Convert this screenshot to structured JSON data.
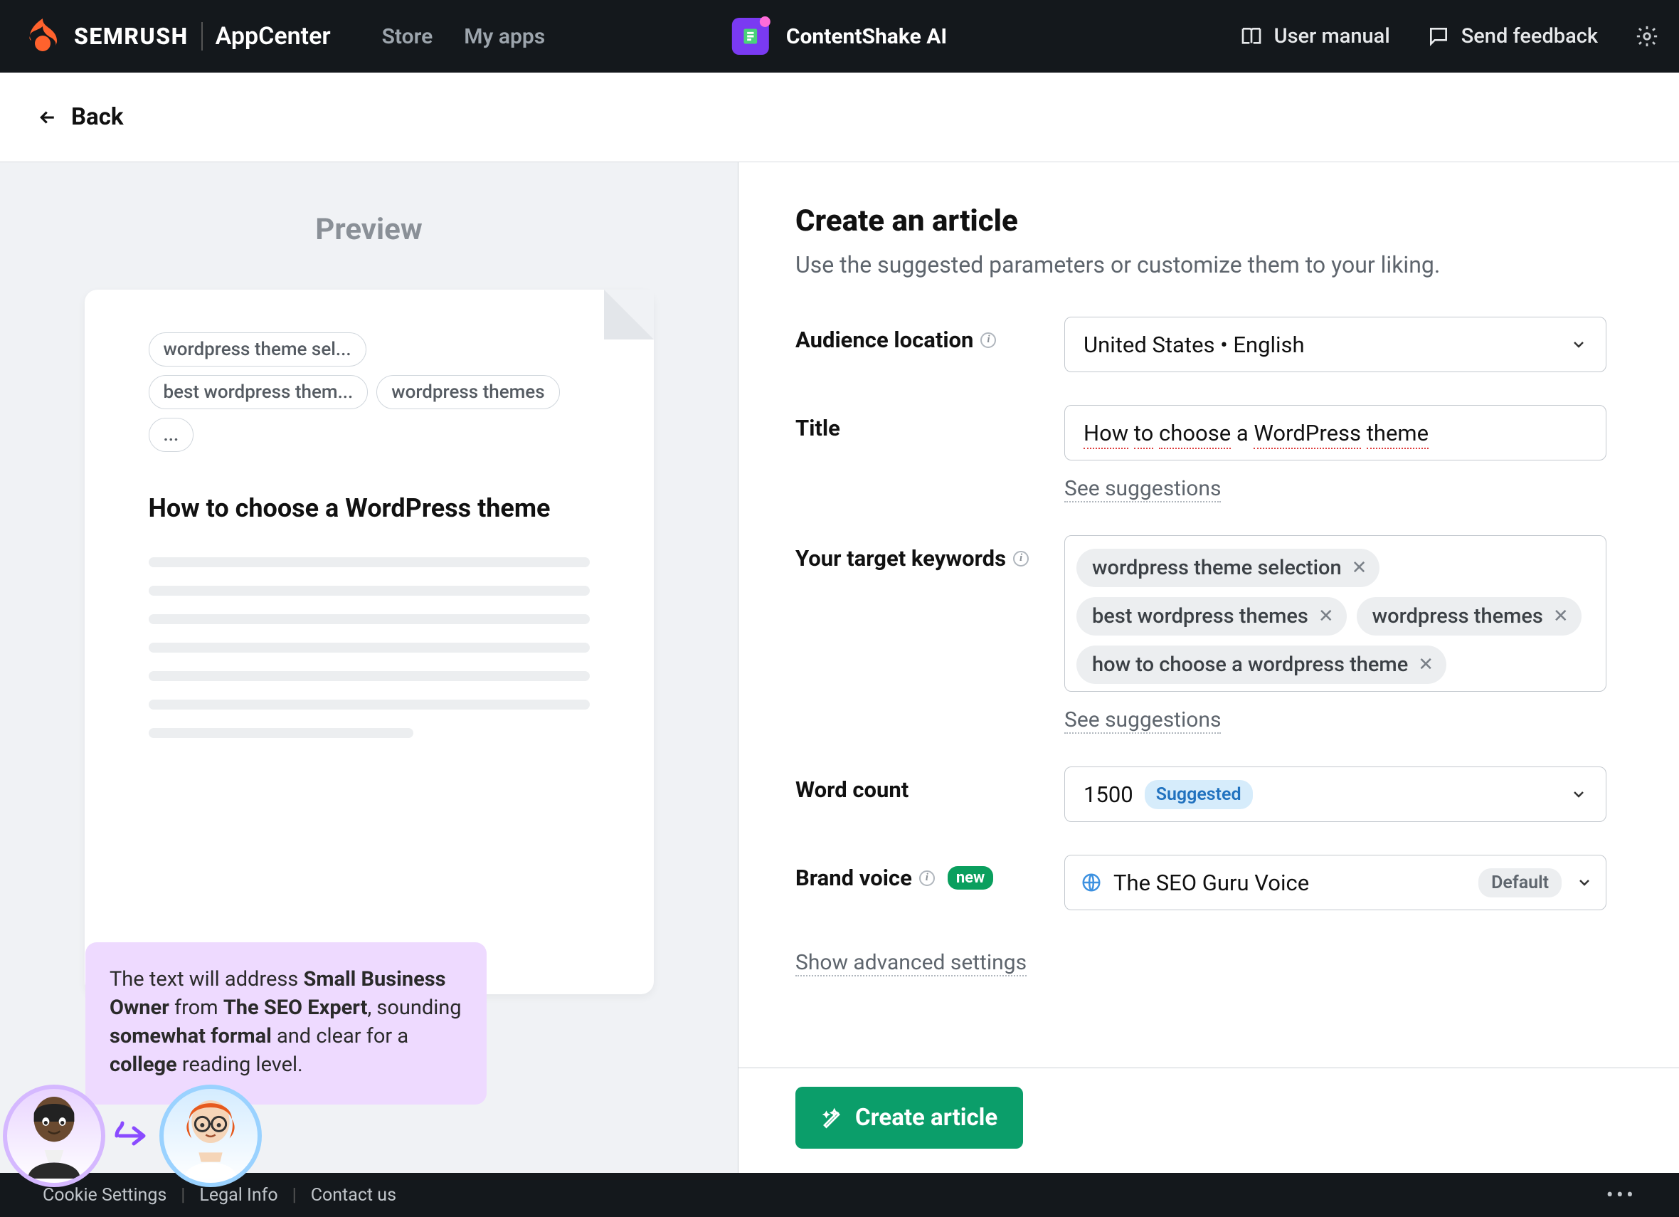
{
  "topbar": {
    "brand": "SEMRUSH",
    "appcenter": "AppCenter",
    "nav": {
      "store": "Store",
      "myapps": "My apps"
    },
    "app_name": "ContentShake AI",
    "right": {
      "user_manual": "User manual",
      "send_feedback": "Send feedback"
    }
  },
  "back": "Back",
  "preview": {
    "heading": "Preview",
    "tags": [
      "wordpress theme sel...",
      "best wordpress them...",
      "wordpress themes",
      "..."
    ],
    "title": "How to choose a WordPress theme",
    "bubble_prefix": "The text will address ",
    "bubble_b1": "Small Business Owner",
    "bubble_mid1": " from ",
    "bubble_b2": "The SEO Expert",
    "bubble_mid2": ", sounding ",
    "bubble_b3": "somewhat formal",
    "bubble_mid3": " and clear for a ",
    "bubble_b4": "college",
    "bubble_end": " reading level."
  },
  "form": {
    "heading": "Create an article",
    "subtitle": "Use the suggested parameters or customize them to your liking.",
    "audience_label": "Audience location",
    "audience_value": "United States • English",
    "title_label": "Title",
    "title_parts": [
      {
        "t": "How",
        "red": true
      },
      {
        "t": " ",
        "red": false
      },
      {
        "t": "to",
        "red": true
      },
      {
        "t": " ",
        "red": false
      },
      {
        "t": "choose",
        "red": true
      },
      {
        "t": " a ",
        "red": false
      },
      {
        "t": "WordPress",
        "red": true
      },
      {
        "t": " ",
        "red": false
      },
      {
        "t": "theme",
        "red": true
      }
    ],
    "see_suggestions": "See suggestions",
    "keywords_label": "Your target keywords",
    "keywords": [
      "wordpress theme selection",
      "best wordpress themes",
      "wordpress themes",
      "how to choose a wordpress theme"
    ],
    "wordcount_label": "Word count",
    "wordcount_value": "1500",
    "suggested_badge": "Suggested",
    "brand_label": "Brand voice",
    "brand_value": "The SEO Guru Voice",
    "default_pill": "Default",
    "new_badge": "new",
    "advanced": "Show advanced settings",
    "create_btn": "Create article"
  },
  "legal": {
    "cookie": "Cookie Settings",
    "legal_info": "Legal Info",
    "contact": "Contact us"
  }
}
